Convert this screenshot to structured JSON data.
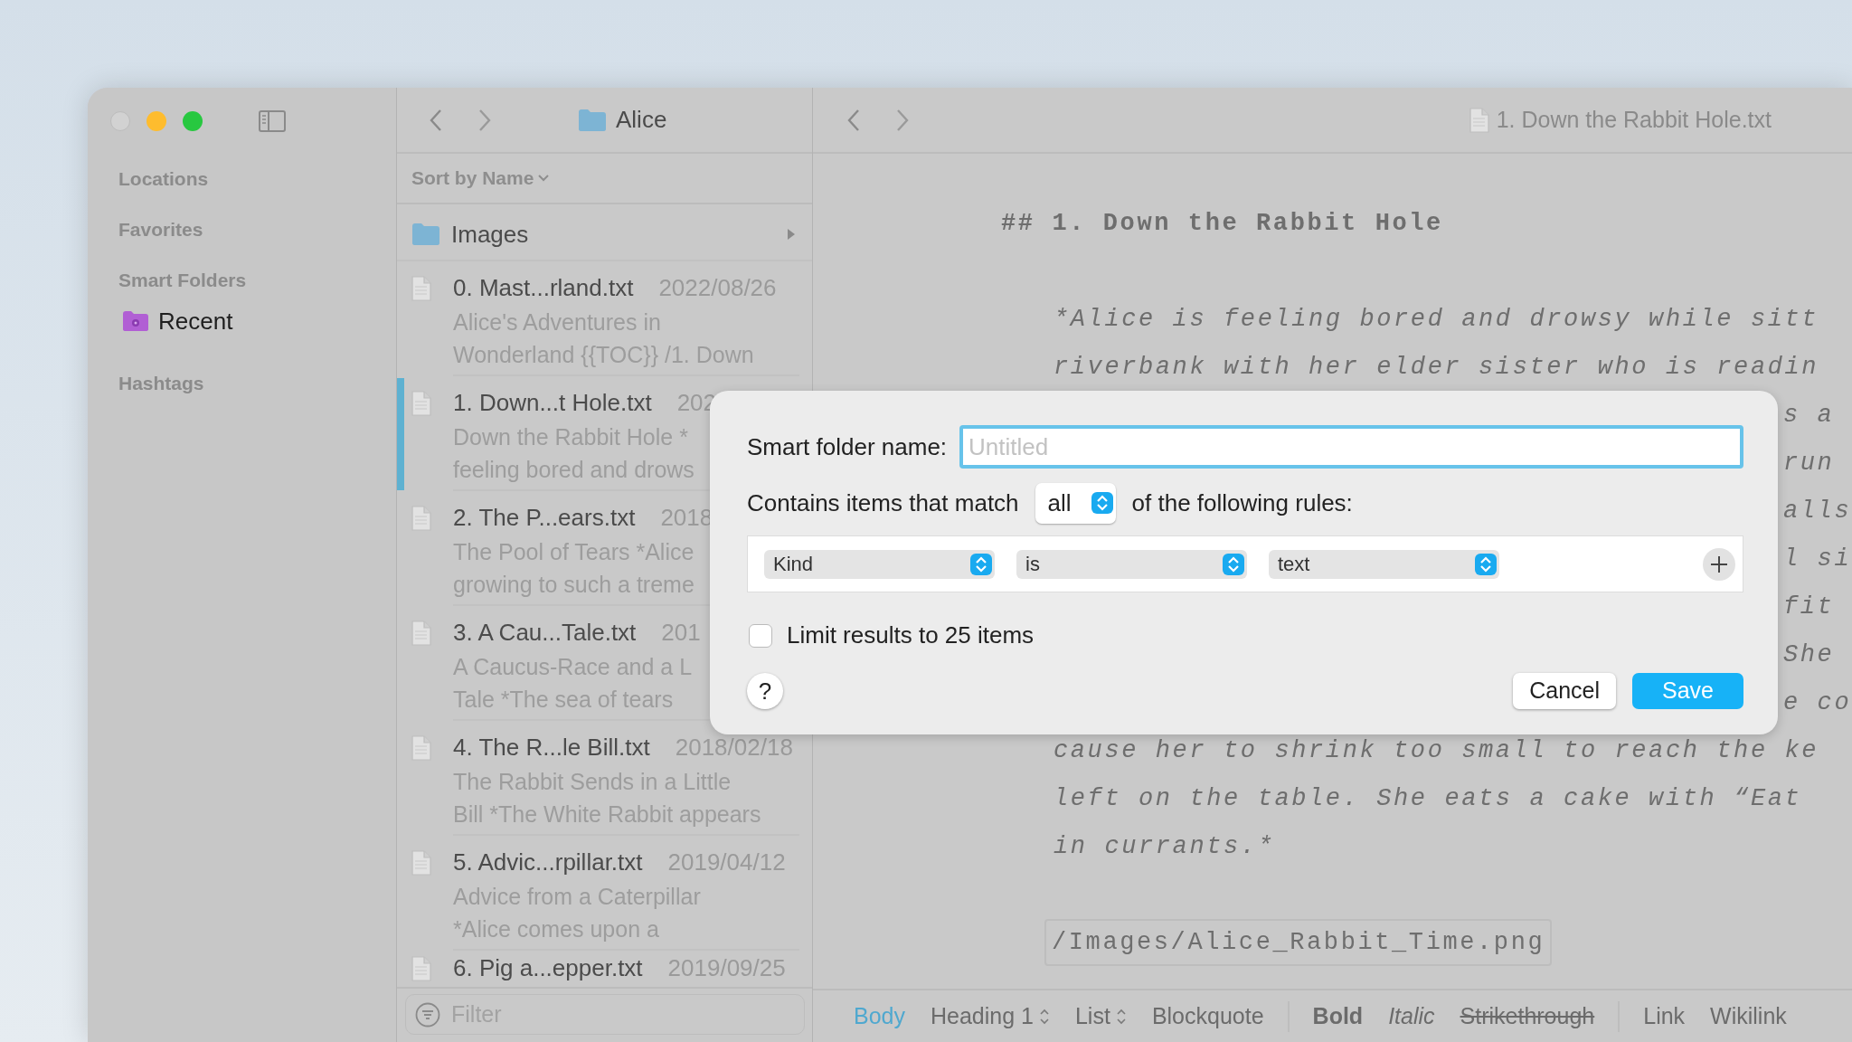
{
  "window": {
    "controls": [
      {
        "kind": "close",
        "disabled": true
      },
      {
        "kind": "minimize",
        "disabled": false
      },
      {
        "kind": "zoom",
        "disabled": false
      }
    ]
  },
  "sidebar": {
    "sections": [
      {
        "title": "Locations"
      },
      {
        "title": "Favorites"
      },
      {
        "title": "Smart Folders",
        "items": [
          {
            "label": "Recent"
          }
        ]
      },
      {
        "title": "Hashtags"
      }
    ]
  },
  "file_list": {
    "folder": "Alice",
    "sort": "Sort by Name",
    "folders": [
      {
        "name": "Images"
      }
    ],
    "files": [
      {
        "title": "0. Mast...rland.txt",
        "date": "2022/08/26",
        "preview": [
          "Alice's Adventures in",
          "Wonderland {{TOC}} /1. Down"
        ],
        "selected": false
      },
      {
        "title": "1. Down...t Hole.txt",
        "date": "202",
        "preview": [
          "Down the Rabbit Hole *",
          "feeling bored and drows"
        ],
        "selected": true
      },
      {
        "title": "2. The P...ears.txt",
        "date": "2018",
        "preview": [
          "The Pool of Tears *Alice",
          "growing to such a treme"
        ],
        "selected": false
      },
      {
        "title": "3. A Cau...Tale.txt",
        "date": "201",
        "preview": [
          "A Caucus-Race and a L",
          "Tale *The sea of tears"
        ],
        "selected": false
      },
      {
        "title": "4. The R...le Bill.txt",
        "date": "2018/02/18",
        "preview": [
          "The Rabbit Sends in a Little",
          "Bill *The White Rabbit appears"
        ],
        "selected": false
      },
      {
        "title": "5. Advic...rpillar.txt",
        "date": "2019/04/12",
        "preview": [
          "Advice from a Caterpillar",
          "*Alice comes upon a"
        ],
        "selected": false
      },
      {
        "title": "6. Pig a...epper.txt",
        "date": "2019/09/25",
        "selected": false
      }
    ],
    "filter": {
      "placeholder": "Filter"
    }
  },
  "editor": {
    "title": "1. Down the Rabbit Hole.txt",
    "lines": [
      {
        "kind": "heading",
        "text": "## 1. Down the Rabbit Hole"
      },
      {
        "kind": "italic",
        "text": "*Alice is feeling bored and drowsy while sitt"
      },
      {
        "kind": "italic",
        "text": "riverbank with her elder sister who is readin"
      },
      {
        "kind": "fragment",
        "text": "s a"
      },
      {
        "kind": "fragment",
        "text": "run"
      },
      {
        "kind": "fragment",
        "text": "alls"
      },
      {
        "kind": "fragment",
        "text": "l si"
      },
      {
        "kind": "fragment",
        "text": "fit"
      },
      {
        "kind": "fragment",
        "text": "She"
      },
      {
        "kind": "fragment",
        "text": "e co"
      },
      {
        "kind": "italic",
        "text": "cause her to shrink too small to reach the ke"
      },
      {
        "kind": "italic",
        "text": "left on the table. She eats a cake with “Eat"
      },
      {
        "kind": "italic",
        "text": "in currants.*"
      },
      {
        "kind": "code",
        "text": "/Images/Alice_Rabbit_Time.png"
      }
    ],
    "toolbar": {
      "groups": [
        [
          {
            "label": "Body",
            "kind": "plain",
            "selected": true
          },
          {
            "label": "Heading 1",
            "kind": "menu",
            "selected": false
          },
          {
            "label": "List",
            "kind": "menu",
            "selected": false
          },
          {
            "label": "Blockquote",
            "kind": "plain",
            "selected": false
          }
        ],
        [
          {
            "label": "Bold",
            "kind": "bold",
            "selected": false
          },
          {
            "label": "Italic",
            "kind": "italic",
            "selected": false
          },
          {
            "label": "Strikethrough",
            "kind": "strike",
            "selected": false
          }
        ],
        [
          {
            "label": "Link",
            "kind": "plain",
            "selected": false
          },
          {
            "label": "Wikilink",
            "kind": "plain",
            "selected": false
          }
        ]
      ]
    }
  },
  "dialog": {
    "name_label": "Smart folder name:",
    "name_field": {
      "placeholder": "Untitled",
      "focused": true
    },
    "match_label": "Contains items that match",
    "match_value": "all",
    "match_suffix": "of the following rules:",
    "rules": [
      {
        "fields": [
          "Kind",
          "is",
          "text"
        ]
      }
    ],
    "limit": {
      "label": "Limit results to 25 items",
      "checked": false
    },
    "help": "?",
    "buttons": [
      {
        "label": "Cancel",
        "primary": false
      },
      {
        "label": "Save",
        "primary": true
      }
    ]
  }
}
